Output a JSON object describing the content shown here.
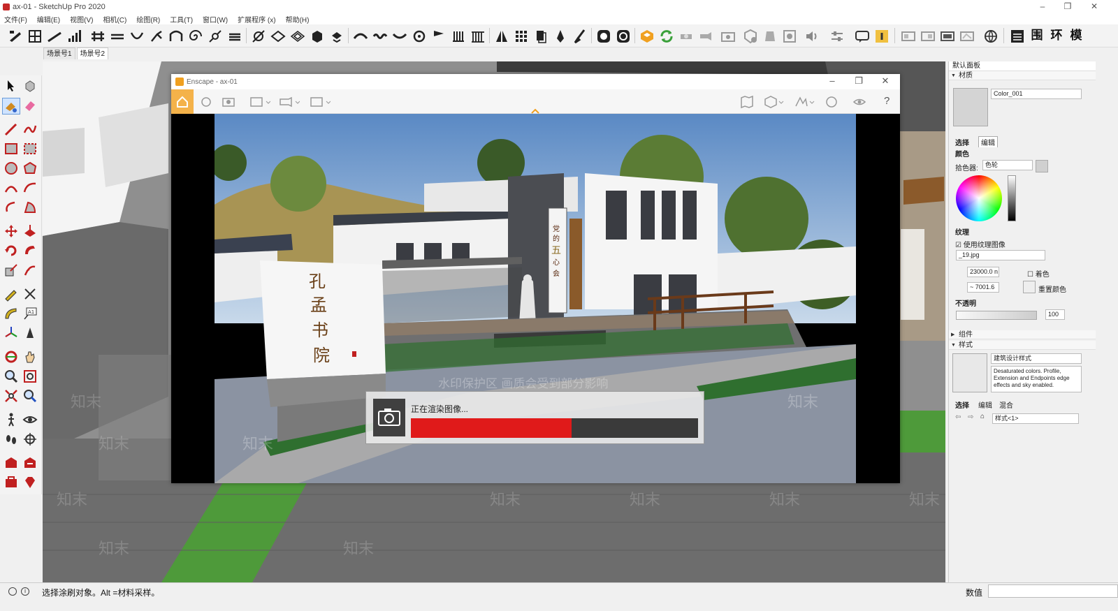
{
  "window": {
    "title": "ax-01 - SketchUp Pro 2020",
    "minimize": "–",
    "restore": "❐",
    "close": "✕"
  },
  "menu": [
    "文件(F)",
    "编辑(E)",
    "视图(V)",
    "相机(C)",
    "绘图(R)",
    "工具(T)",
    "窗口(W)",
    "扩展程序 (x)",
    "帮助(H)"
  ],
  "toolbar": {
    "text_buttons": [
      "围",
      "环",
      "模"
    ]
  },
  "scenes": [
    "场景号1",
    "场景号2"
  ],
  "enscape": {
    "title": "Enscape - ax-01",
    "help": "?",
    "progress": {
      "message": "正在渲染图像...",
      "value": 0.56
    },
    "render_sign": [
      "孔",
      "孟",
      "书",
      "院"
    ],
    "render_pillar": [
      "党",
      "的",
      "五",
      "心",
      "会"
    ]
  },
  "watermarks": {
    "brand": "知末",
    "notice": "水印保护区  画质会受到部分影响"
  },
  "tray": {
    "title": "默认面板",
    "materials": {
      "header": "材质",
      "name": "Color_001",
      "tab_select": "选择",
      "tab_edit": "编辑",
      "color_label": "颜色",
      "picker_label": "拾色器:",
      "picker_value": "色轮",
      "texture_label": "纹理",
      "use_texture": "使用纹理图像",
      "texture_file": "_19.jpg",
      "width": "23000.0 n",
      "height": "~ 7001.6",
      "colorize": "着色",
      "reset_color": "重置颜色",
      "opacity_label": "不透明",
      "opacity_value": "100"
    },
    "components": {
      "header": "组件"
    },
    "styles": {
      "header": "样式",
      "name": "建筑设计样式",
      "description": "Desaturated colors. Profile, Extension and Endpoints edge effects and sky enabled.",
      "tab_select": "选择",
      "tab_edit": "编辑",
      "tab_mix": "混合",
      "dropdown": "样式<1>"
    }
  },
  "status": {
    "message": "选择涂刷对象。Alt =材料采样。",
    "vcb_label": "数值",
    "vcb_value": ""
  }
}
